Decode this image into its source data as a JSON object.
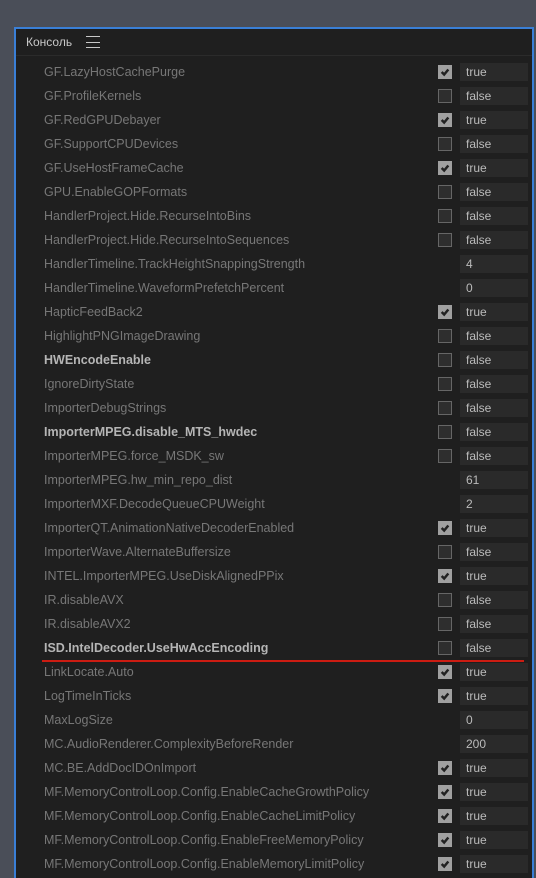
{
  "header": {
    "title": "Консоль"
  },
  "rows": [
    {
      "label": "GF.LazyHostCachePurge",
      "checkbox": true,
      "value": "true"
    },
    {
      "label": "GF.ProfileKernels",
      "checkbox": false,
      "value": "false"
    },
    {
      "label": "GF.RedGPUDebayer",
      "checkbox": true,
      "value": "true"
    },
    {
      "label": "GF.SupportCPUDevices",
      "checkbox": false,
      "value": "false"
    },
    {
      "label": "GF.UseHostFrameCache",
      "checkbox": true,
      "value": "true"
    },
    {
      "label": "GPU.EnableGOPFormats",
      "checkbox": false,
      "value": "false"
    },
    {
      "label": "HandlerProject.Hide.RecurseIntoBins",
      "checkbox": false,
      "value": "false"
    },
    {
      "label": "HandlerProject.Hide.RecurseIntoSequences",
      "checkbox": false,
      "value": "false"
    },
    {
      "label": "HandlerTimeline.TrackHeightSnappingStrength",
      "checkbox": null,
      "value": "4"
    },
    {
      "label": "HandlerTimeline.WaveformPrefetchPercent",
      "checkbox": null,
      "value": "0"
    },
    {
      "label": "HapticFeedBack2",
      "checkbox": true,
      "value": "true"
    },
    {
      "label": "HighlightPNGImageDrawing",
      "checkbox": false,
      "value": "false"
    },
    {
      "label": "HWEncodeEnable",
      "checkbox": false,
      "value": "false",
      "bold": true
    },
    {
      "label": "IgnoreDirtyState",
      "checkbox": false,
      "value": "false"
    },
    {
      "label": "ImporterDebugStrings",
      "checkbox": false,
      "value": "false"
    },
    {
      "label": "ImporterMPEG.disable_MTS_hwdec",
      "checkbox": false,
      "value": "false",
      "bold": true
    },
    {
      "label": "ImporterMPEG.force_MSDK_sw",
      "checkbox": false,
      "value": "false"
    },
    {
      "label": "ImporterMPEG.hw_min_repo_dist",
      "checkbox": null,
      "value": "61"
    },
    {
      "label": "ImporterMXF.DecodeQueueCPUWeight",
      "checkbox": null,
      "value": "2"
    },
    {
      "label": "ImporterQT.AnimationNativeDecoderEnabled",
      "checkbox": true,
      "value": "true"
    },
    {
      "label": "ImporterWave.AlternateBuffersize",
      "checkbox": false,
      "value": "false"
    },
    {
      "label": "INTEL.ImporterMPEG.UseDiskAlignedPPix",
      "checkbox": true,
      "value": "true"
    },
    {
      "label": "IR.disableAVX",
      "checkbox": false,
      "value": "false"
    },
    {
      "label": "IR.disableAVX2",
      "checkbox": false,
      "value": "false"
    },
    {
      "label": "ISD.IntelDecoder.UseHwAccEncoding",
      "checkbox": false,
      "value": "false",
      "bold": true,
      "underline": true
    },
    {
      "label": "LinkLocate.Auto",
      "checkbox": true,
      "value": "true"
    },
    {
      "label": "LogTimeInTicks",
      "checkbox": true,
      "value": "true"
    },
    {
      "label": "MaxLogSize",
      "checkbox": null,
      "value": "0"
    },
    {
      "label": "MC.AudioRenderer.ComplexityBeforeRender",
      "checkbox": null,
      "value": "200"
    },
    {
      "label": "MC.BE.AddDocIDOnImport",
      "checkbox": true,
      "value": "true"
    },
    {
      "label": "MF.MemoryControlLoop.Config.EnableCacheGrowthPolicy",
      "checkbox": true,
      "value": "true"
    },
    {
      "label": "MF.MemoryControlLoop.Config.EnableCacheLimitPolicy",
      "checkbox": true,
      "value": "true"
    },
    {
      "label": "MF.MemoryControlLoop.Config.EnableFreeMemoryPolicy",
      "checkbox": true,
      "value": "true"
    },
    {
      "label": "MF.MemoryControlLoop.Config.EnableMemoryLimitPolicy",
      "checkbox": true,
      "value": "true"
    }
  ]
}
